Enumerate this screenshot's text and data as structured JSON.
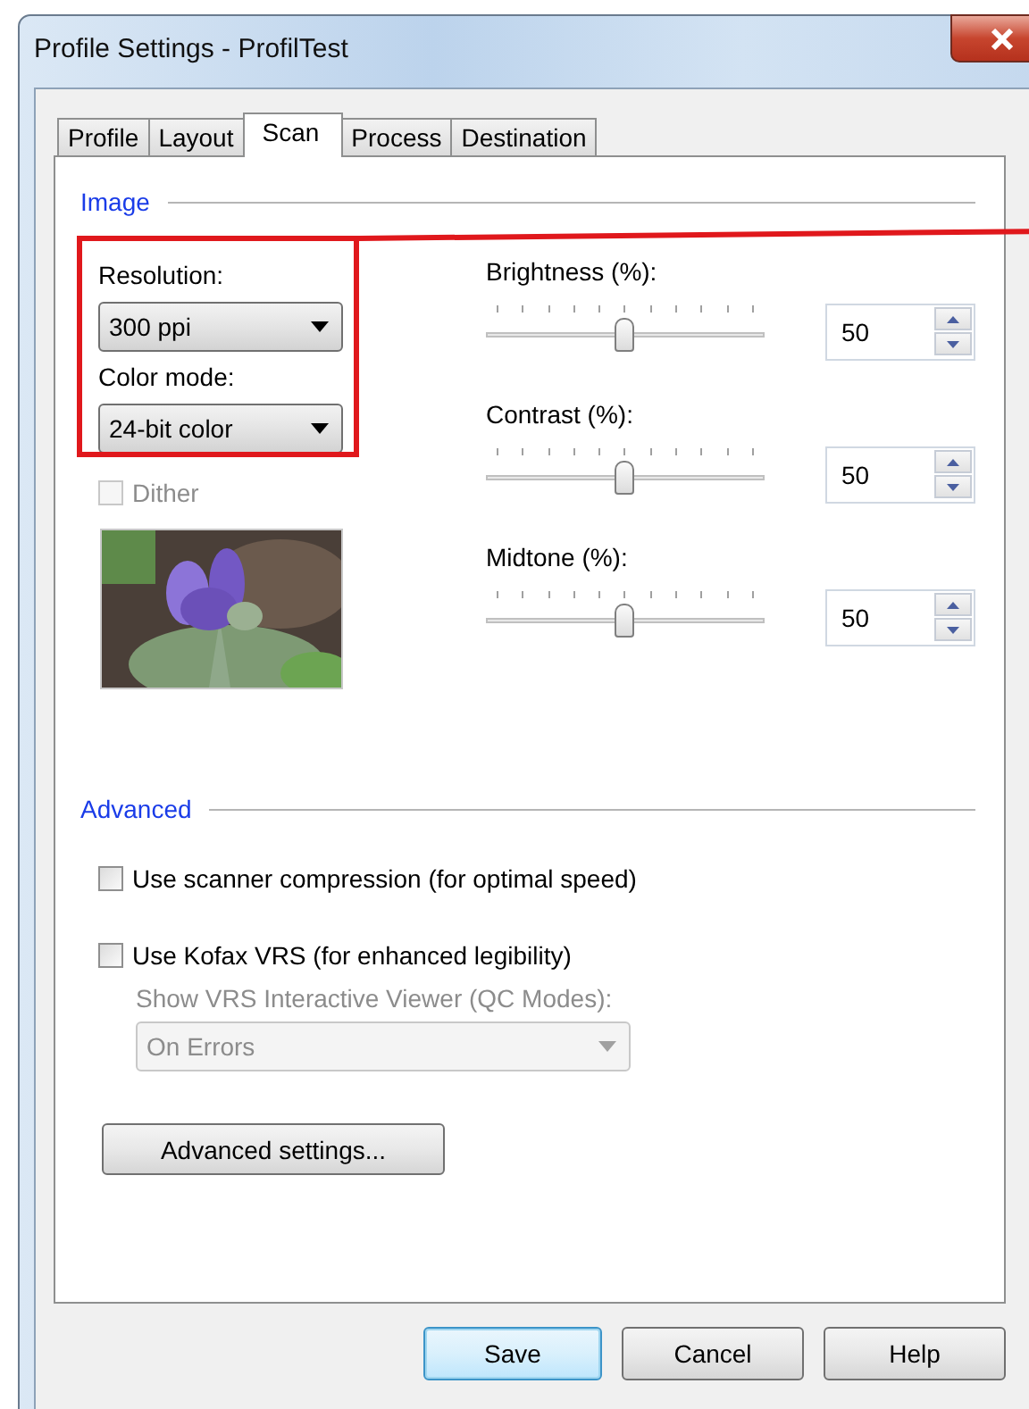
{
  "window": {
    "title": "Profile Settings - ProfilTest"
  },
  "tabs": [
    {
      "label": "Profile",
      "selected": false
    },
    {
      "label": "Layout",
      "selected": false
    },
    {
      "label": "Scan",
      "selected": true
    },
    {
      "label": "Process",
      "selected": false
    },
    {
      "label": "Destination",
      "selected": false
    }
  ],
  "image_section": {
    "heading": "Image",
    "resolution": {
      "label": "Resolution:",
      "value": "300 ppi"
    },
    "color_mode": {
      "label": "Color mode:",
      "value": "24-bit color"
    },
    "dither": {
      "label": "Dither",
      "checked": false,
      "disabled": true
    },
    "sliders": [
      {
        "label": "Brightness (%):",
        "level": 0.5,
        "value": "50"
      },
      {
        "label": "Contrast (%):",
        "level": 0.5,
        "value": "50"
      },
      {
        "label": "Midtone (%):",
        "level": 0.5,
        "value": "50"
      }
    ]
  },
  "advanced_section": {
    "heading": "Advanced",
    "options": [
      {
        "label": "Use scanner compression (for optimal speed)",
        "checked": false
      },
      {
        "label": "Use Kofax VRS (for enhanced legibility)",
        "checked": false
      }
    ],
    "viewer": {
      "label": "Show VRS Interactive Viewer (QC Modes):",
      "value": "On Errors",
      "disabled": true
    },
    "settings_button": "Advanced settings..."
  },
  "highlight": {
    "shown": true
  },
  "buttons": [
    {
      "label": "Save",
      "default": true
    },
    {
      "label": "Cancel",
      "default": false
    },
    {
      "label": "Help",
      "default": false
    }
  ]
}
